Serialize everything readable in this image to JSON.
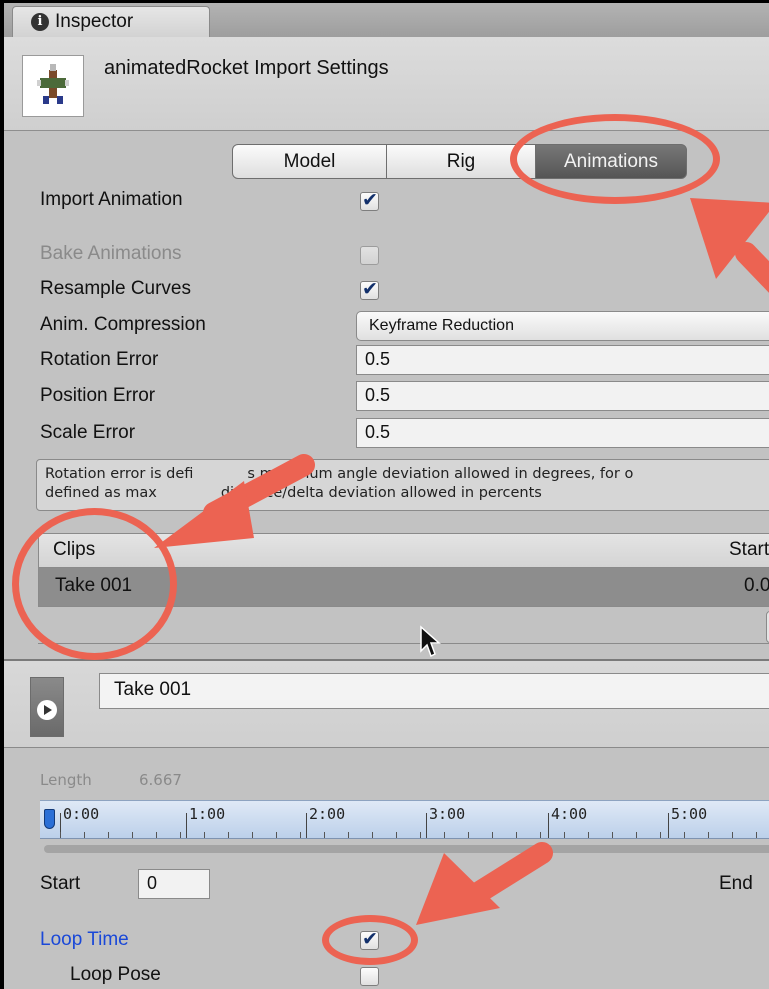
{
  "window": {
    "tab_title": "Inspector"
  },
  "header": {
    "title": "animatedRocket Import Settings",
    "thumbnail": "rocket-model-icon"
  },
  "tabs": [
    "Model",
    "Rig",
    "Animations"
  ],
  "active_tab": "Animations",
  "settings": {
    "import_animation": {
      "label": "Import Animation",
      "checked": true
    },
    "bake_animations": {
      "label": "Bake Animations",
      "checked": false,
      "disabled": true
    },
    "resample_curves": {
      "label": "Resample Curves",
      "checked": true
    },
    "anim_compression": {
      "label": "Anim. Compression",
      "value": "Keyframe Reduction"
    },
    "rotation_error": {
      "label": "Rotation Error",
      "value": "0.5"
    },
    "position_error": {
      "label": "Position Error",
      "value": "0.5"
    },
    "scale_error": {
      "label": "Scale Error",
      "value": "0.5"
    }
  },
  "help_lines": [
    "Rotation error is defi",
    "s maximum angle deviation allowed in degrees, for o",
    "defined as max",
    "distance/delta deviation allowed in percents"
  ],
  "clips_table": {
    "headers": [
      "Clips",
      "Start"
    ],
    "rows": [
      {
        "name": "Take 001",
        "start": "0.0"
      }
    ]
  },
  "preview": {
    "clip_name": "Take 001"
  },
  "clip": {
    "length_label": "Length",
    "length_value": "6.667",
    "timeline_ticks": [
      "0:00",
      "1:00",
      "2:00",
      "3:00",
      "4:00",
      "5:00"
    ],
    "start_label": "Start",
    "start_value": "0",
    "end_label": "End",
    "loop_time": {
      "label": "Loop Time",
      "checked": true
    },
    "loop_pose": {
      "label": "Loop Pose",
      "checked": false
    }
  },
  "colors": {
    "annotation": "#ec6352",
    "link_blue": "#1a48d8",
    "active_tab": "#5f5f5f"
  }
}
